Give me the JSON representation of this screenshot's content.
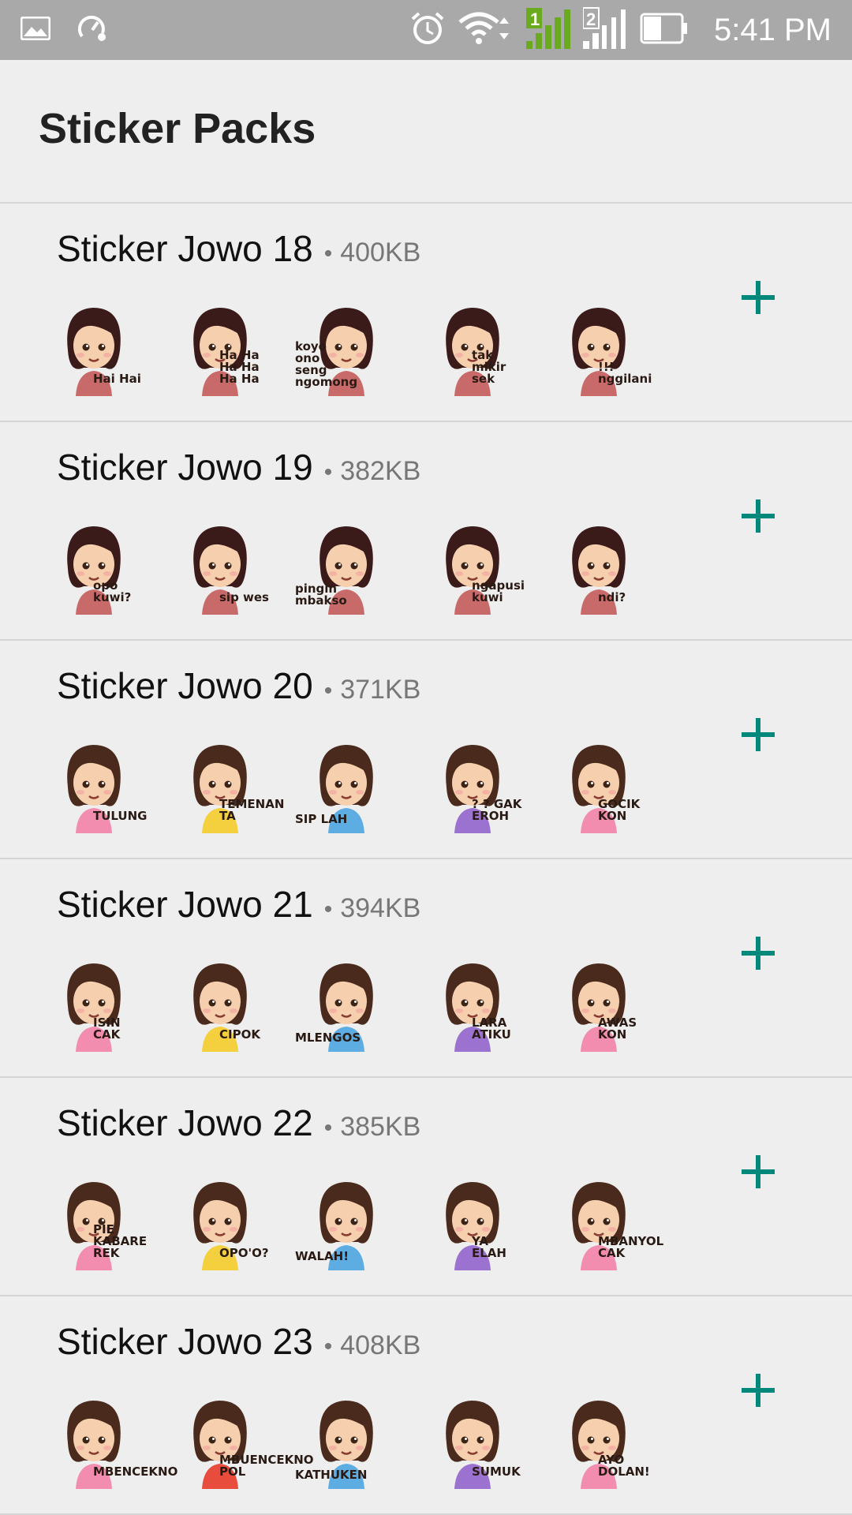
{
  "status_bar": {
    "time": "5:41 PM",
    "left_icons": [
      "image-icon",
      "speed-settings-icon"
    ],
    "right_icons": [
      "alarm-icon",
      "wifi-icon",
      "signal-sim1-icon",
      "signal-sim2-icon",
      "battery-icon"
    ],
    "sim1_label": "1",
    "sim2_label": "2"
  },
  "header": {
    "title": "Sticker Packs"
  },
  "colors": {
    "accent": "#00897b",
    "background": "#eeeeee"
  },
  "packs": [
    {
      "name": "Sticker Jowo 18",
      "separator": "•",
      "size": "400KB",
      "stickers": [
        {
          "caption": "Hai Hai",
          "hair": "#3b1a1a",
          "shirt": "#c86a6a"
        },
        {
          "caption": "Ha Ha Ha Ha Ha Ha",
          "hair": "#3b1a1a",
          "shirt": "#c86a6a"
        },
        {
          "caption": "koyo ono seng ngomong",
          "hair": "#3b1a1a",
          "shirt": "#c86a6a"
        },
        {
          "caption": "tak mikir sek",
          "hair": "#3b1a1a",
          "shirt": "#c86a6a"
        },
        {
          "caption": "!!! nggilani",
          "hair": "#3b1a1a",
          "shirt": "#c86a6a"
        }
      ]
    },
    {
      "name": "Sticker Jowo 19",
      "separator": "•",
      "size": "382KB",
      "stickers": [
        {
          "caption": "opo kuwi?",
          "hair": "#3b1a1a",
          "shirt": "#c86a6a"
        },
        {
          "caption": "sip wes",
          "hair": "#3b1a1a",
          "shirt": "#c86a6a"
        },
        {
          "caption": "pingin mbakso",
          "hair": "#3b1a1a",
          "shirt": "#c86a6a"
        },
        {
          "caption": "ngapusi kuwi",
          "hair": "#3b1a1a",
          "shirt": "#c86a6a"
        },
        {
          "caption": "ndi?",
          "hair": "#3b1a1a",
          "shirt": "#c86a6a"
        }
      ]
    },
    {
      "name": "Sticker Jowo 20",
      "separator": "•",
      "size": "371KB",
      "stickers": [
        {
          "caption": "TULUNG",
          "hair": "#4a2a1c",
          "shirt": "#f28db0"
        },
        {
          "caption": "TEMENAN TA",
          "hair": "#4a2a1c",
          "shirt": "#f4d03f"
        },
        {
          "caption": "SIP LAH",
          "hair": "#4a2a1c",
          "shirt": "#5dade2"
        },
        {
          "caption": "? ? GAK EROH",
          "hair": "#4a2a1c",
          "shirt": "#9b72cf"
        },
        {
          "caption": "GOCIK KON",
          "hair": "#4a2a1c",
          "shirt": "#f28db0"
        }
      ]
    },
    {
      "name": "Sticker Jowo 21",
      "separator": "•",
      "size": "394KB",
      "stickers": [
        {
          "caption": "ISIN CAK",
          "hair": "#4a2a1c",
          "shirt": "#f28db0"
        },
        {
          "caption": "CIPOK",
          "hair": "#4a2a1c",
          "shirt": "#f4d03f"
        },
        {
          "caption": "MLENGOS",
          "hair": "#4a2a1c",
          "shirt": "#5dade2"
        },
        {
          "caption": "LARA ATIKU",
          "hair": "#4a2a1c",
          "shirt": "#9b72cf"
        },
        {
          "caption": "AWAS KON",
          "hair": "#4a2a1c",
          "shirt": "#f28db0"
        }
      ]
    },
    {
      "name": "Sticker Jowo 22",
      "separator": "•",
      "size": "385KB",
      "stickers": [
        {
          "caption": "PIE KABARE REK",
          "hair": "#4a2a1c",
          "shirt": "#f28db0"
        },
        {
          "caption": "OPO'O?",
          "hair": "#4a2a1c",
          "shirt": "#f4d03f"
        },
        {
          "caption": "WALAH!",
          "hair": "#4a2a1c",
          "shirt": "#5dade2"
        },
        {
          "caption": "YA ELAH",
          "hair": "#4a2a1c",
          "shirt": "#9b72cf"
        },
        {
          "caption": "MBANYOL CAK",
          "hair": "#4a2a1c",
          "shirt": "#f28db0"
        }
      ]
    },
    {
      "name": "Sticker Jowo 23",
      "separator": "•",
      "size": "408KB",
      "stickers": [
        {
          "caption": "MBENCEKNO",
          "hair": "#4a2a1c",
          "shirt": "#f28db0"
        },
        {
          "caption": "MBUENCEKNO POL",
          "hair": "#4a2a1c",
          "shirt": "#e74c3c"
        },
        {
          "caption": "KATHUKEN",
          "hair": "#4a2a1c",
          "shirt": "#5dade2"
        },
        {
          "caption": "SUMUK",
          "hair": "#4a2a1c",
          "shirt": "#9b72cf"
        },
        {
          "caption": "AYO DOLAN!",
          "hair": "#4a2a1c",
          "shirt": "#f28db0"
        }
      ]
    }
  ]
}
